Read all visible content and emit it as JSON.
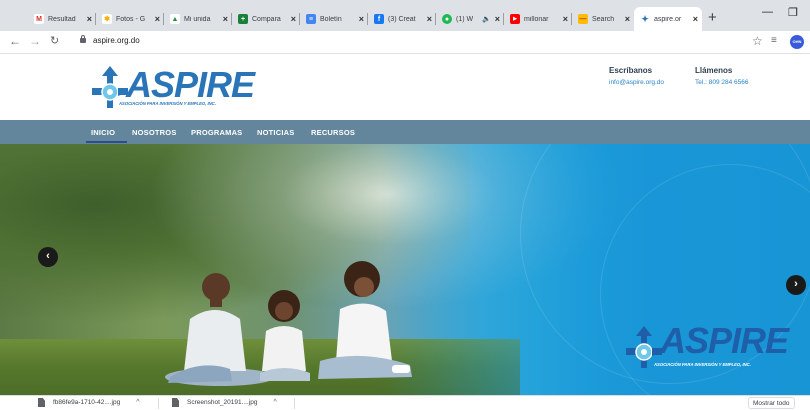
{
  "browser": {
    "tabs": [
      {
        "label": "Resultad",
        "favicon_color": "#d93025",
        "favicon_glyph": "M"
      },
      {
        "label": "Fotos - G",
        "favicon_color": "#f9ab00",
        "favicon_glyph": "✱"
      },
      {
        "label": "Mi unida",
        "favicon_color": "#1e8e3e",
        "favicon_glyph": "▲"
      },
      {
        "label": "Compara",
        "favicon_color": "#188038",
        "favicon_glyph": "+"
      },
      {
        "label": "Boletín",
        "favicon_color": "#4285f4",
        "favicon_glyph": "≡"
      },
      {
        "label": "(3) Creat",
        "favicon_color": "#1877f2",
        "favicon_glyph": "f"
      },
      {
        "label": "(1) W",
        "favicon_color": "#1db954",
        "favicon_glyph": "●"
      },
      {
        "label": "millonar",
        "favicon_color": "#ff0000",
        "favicon_glyph": "▶"
      },
      {
        "label": "Search",
        "favicon_color": "#fbbc04",
        "favicon_glyph": "—"
      },
      {
        "label": "aspire.or",
        "favicon_color": "#2a74b8",
        "favicon_glyph": "✦",
        "active": true
      }
    ],
    "new_tab": "+",
    "url": "aspire.org.do",
    "profile_initials": "OHN"
  },
  "site": {
    "logo": {
      "name": "ASPIRE",
      "tagline": "ASOCIACIÓN PARA INVERSIÓN Y EMPLEO, INC."
    },
    "contact": {
      "email_title": "Escríbanos",
      "email": "info@aspire.org.do",
      "phone_title": "Llámenos",
      "phone": "Tel.: 809 284 6566"
    },
    "nav": [
      "INICIO",
      "NOSOTROS",
      "PROGRAMAS",
      "NOTICIAS",
      "RECURSOS"
    ],
    "hero": {
      "prev": "‹",
      "next": "›"
    }
  },
  "downloads": {
    "items": [
      {
        "name": "fb86fe9a-1710-42....jpg"
      },
      {
        "name": "Screenshot_20191....jpg"
      }
    ],
    "show_all": "Mostrar todo"
  },
  "colors": {
    "brand_blue": "#2a74b8",
    "nav_bg": "#63869d",
    "nav_active_underline": "#2d4e86"
  }
}
